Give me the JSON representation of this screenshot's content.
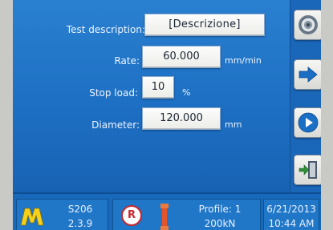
{
  "form": {
    "test_description_label": "Test description:",
    "test_description_value": "[Descrizione]",
    "rate_label": "Rate:",
    "rate_value": "60.000",
    "rate_unit": "mm/min",
    "stop_load_label": "Stop load:",
    "stop_load_value": "10",
    "stop_load_unit": "%",
    "diameter_label": "Diameter:",
    "diameter_value": "120.000",
    "diameter_unit": "mm"
  },
  "sidebar": {
    "buttons": [
      {
        "name": "settings-dial-button",
        "icon": "dial-icon"
      },
      {
        "name": "next-button",
        "icon": "arrow-right-icon"
      },
      {
        "name": "play-button",
        "icon": "play-icon"
      },
      {
        "name": "exit-button",
        "icon": "exit-door-icon"
      }
    ]
  },
  "status": {
    "logo_letter": "M",
    "model": "S206",
    "version": "2.3.9",
    "record_badge": "R",
    "profile": "Profile: 1",
    "capacity": "200kN",
    "date": "6/21/2013",
    "time": "10:44 AM"
  },
  "colors": {
    "screen_blue": "#1c70c2",
    "logo_yellow": "#f4d21c",
    "record_red": "#c8262c",
    "icon_blue": "#1a6fc4"
  }
}
